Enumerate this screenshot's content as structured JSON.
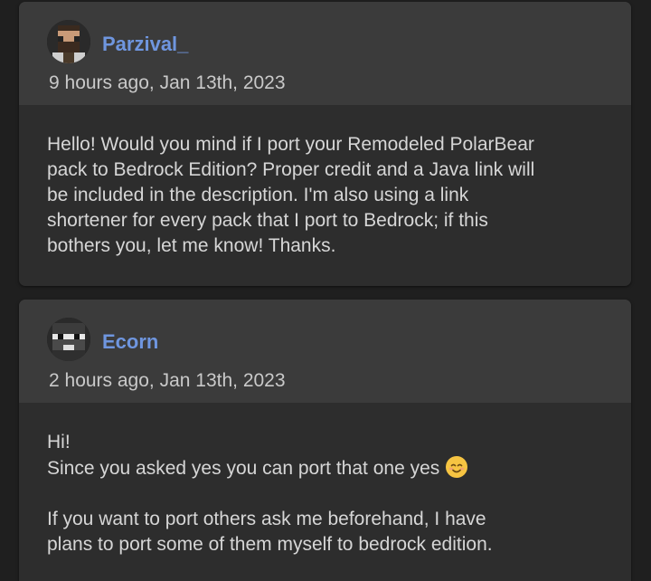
{
  "comments": [
    {
      "author": "Parzival_",
      "timestamp": "9 hours ago, Jan 13th, 2023",
      "avatar_icon": "minecraft-skin-avatar-bearded",
      "body": "Hello! Would you mind if I port your Remodeled PolarBear\npack to Bedrock Edition? Proper credit and a Java link will\nbe included in the description. I'm also using a link\nshortener for every pack that I port to Bedrock; if this\nbothers you, let me know! Thanks."
    },
    {
      "author": "Ecorn",
      "timestamp": "2 hours ago, Jan 13th, 2023",
      "avatar_icon": "minecraft-skin-avatar-masked",
      "body_line1": "Hi!",
      "body_line2": "Since you asked yes you can port that one yes",
      "emoji": "smiling-face-emoji",
      "body_line3": "If you want to port others ask me beforehand, I have\nplans to port some of them myself to bedrock edition."
    }
  ],
  "colors": {
    "background": "#1f1f1f",
    "card": "#2d2d2d",
    "card_header": "#3b3b3b",
    "author_link": "#6f96df",
    "text": "#d6d6d6"
  }
}
